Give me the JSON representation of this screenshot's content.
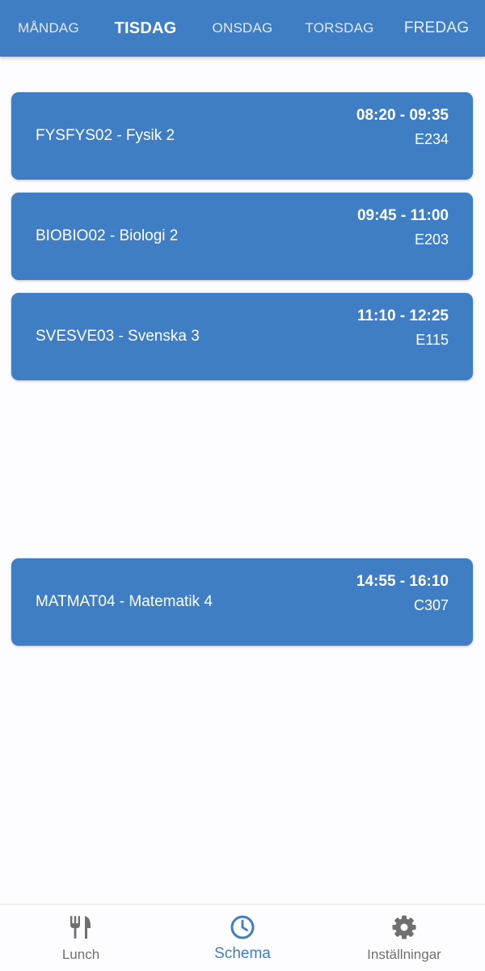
{
  "colors": {
    "primary": "#3f7ec4",
    "background": "#fdfdff",
    "inactive_nav": "#6f6f6f"
  },
  "day_tabs": [
    {
      "label": "MÅNDAG",
      "active": false
    },
    {
      "label": "TISDAG",
      "active": true
    },
    {
      "label": "ONSDAG",
      "active": false
    },
    {
      "label": "TORSDAG",
      "active": false
    },
    {
      "label": "FREDAG",
      "active": false
    }
  ],
  "lessons": [
    {
      "course": "FYSFYS02 - Fysik 2",
      "time": "08:20 - 09:35",
      "room": "E234"
    },
    {
      "course": "BIOBIO02 - Biologi 2",
      "time": "09:45 - 11:00",
      "room": "E203"
    },
    {
      "course": "SVESVE03 - Svenska 3",
      "time": "11:10 - 12:25",
      "room": "E115"
    },
    {
      "course": "MATMAT04 - Matematik 4",
      "time": "14:55 - 16:10",
      "room": "C307"
    }
  ],
  "bottom_nav": [
    {
      "label": "Lunch",
      "icon": "fork-knife-icon",
      "active": false
    },
    {
      "label": "Schema",
      "icon": "clock-icon",
      "active": true
    },
    {
      "label": "Inställningar",
      "icon": "gear-icon",
      "active": false
    }
  ]
}
